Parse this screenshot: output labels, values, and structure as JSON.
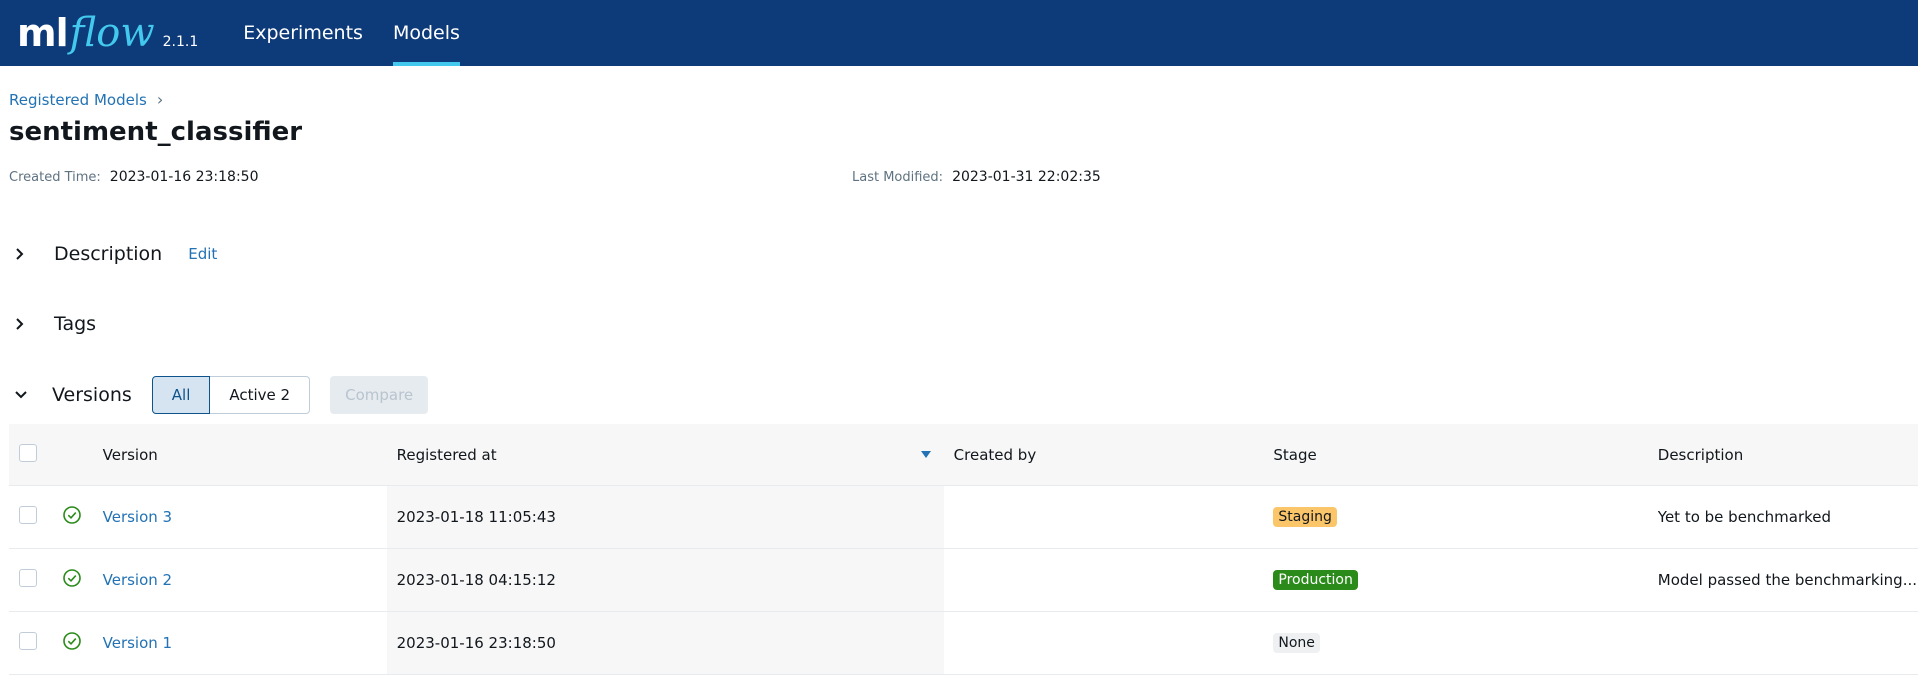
{
  "app": {
    "logo_ml": "ml",
    "logo_flow": "flow",
    "version": "2.1.1",
    "nav": [
      {
        "label": "Experiments",
        "active": false
      },
      {
        "label": "Models",
        "active": true
      }
    ]
  },
  "breadcrumb": {
    "root": "Registered Models",
    "separator": "›"
  },
  "model": {
    "name": "sentiment_classifier",
    "created_label": "Created Time:",
    "created_value": "2023-01-16 23:18:50",
    "modified_label": "Last Modified:",
    "modified_value": "2023-01-31 22:02:35"
  },
  "sections": {
    "description": {
      "title": "Description",
      "edit_label": "Edit",
      "expanded": false
    },
    "tags": {
      "title": "Tags",
      "expanded": false
    },
    "versions": {
      "title": "Versions",
      "expanded": true
    }
  },
  "filters": {
    "all_label": "All",
    "active_label": "Active 2",
    "compare_label": "Compare"
  },
  "table": {
    "headers": {
      "version": "Version",
      "registered_at": "Registered at",
      "created_by": "Created by",
      "stage": "Stage",
      "description": "Description"
    },
    "rows": [
      {
        "version": "Version 3",
        "registered_at": "2023-01-18 11:05:43",
        "created_by": "",
        "stage": "Staging",
        "stage_bg": "#fbc56a",
        "stage_fg": "#11171c",
        "description": "Yet to be benchmarked"
      },
      {
        "version": "Version 2",
        "registered_at": "2023-01-18 04:15:12",
        "created_by": "",
        "stage": "Production",
        "stage_bg": "#2a8b1a",
        "stage_fg": "#ffffff",
        "description": "Model passed the benchmarking..."
      },
      {
        "version": "Version 1",
        "registered_at": "2023-01-16 23:18:50",
        "created_by": "",
        "stage": "None",
        "stage_bg": "#eef0f2",
        "stage_fg": "#11171c",
        "description": ""
      }
    ]
  },
  "colors": {
    "header_bg": "#0d3a78",
    "accent": "#43c9ed",
    "link": "#2272b4",
    "status_ok": "#2a8b1a"
  }
}
